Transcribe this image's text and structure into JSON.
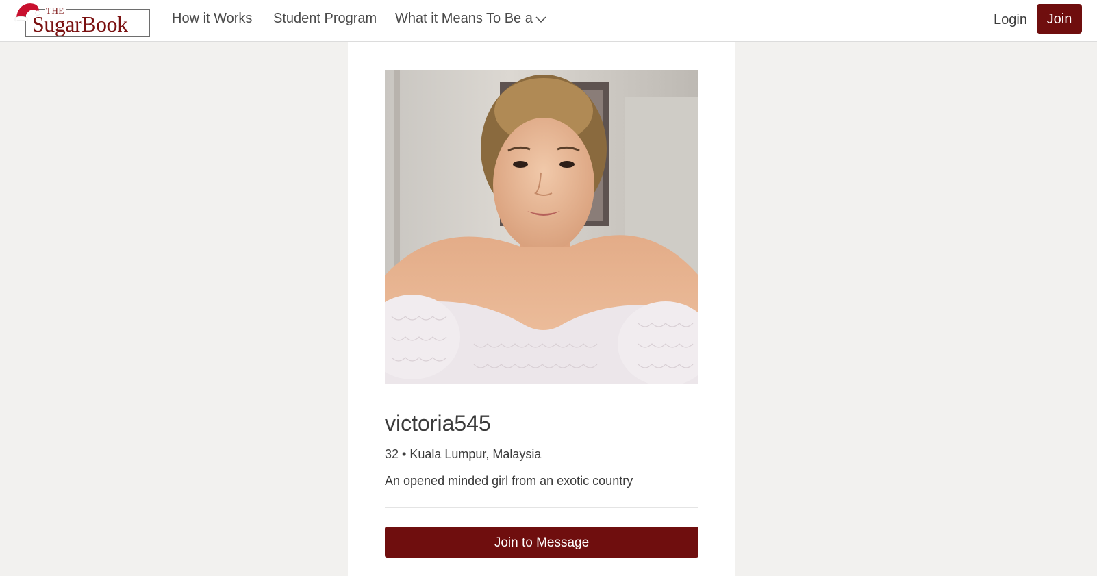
{
  "brand": {
    "logo_top": "THE",
    "logo_main": "SugarBook",
    "accent_color": "#6f0e0e"
  },
  "nav": {
    "items": [
      {
        "label": "How it Works"
      },
      {
        "label": "Student Program"
      },
      {
        "label": "What it Means To Be a",
        "icon": "chevron-down-icon"
      }
    ],
    "login_label": "Login",
    "join_label": "Join"
  },
  "profile": {
    "photo_alt": "profile-photo",
    "username": "victoria545",
    "meta": "32 • Kuala Lumpur, Malaysia",
    "tagline": "An opened minded girl from an exotic country",
    "cta_label": "Join to Message"
  }
}
